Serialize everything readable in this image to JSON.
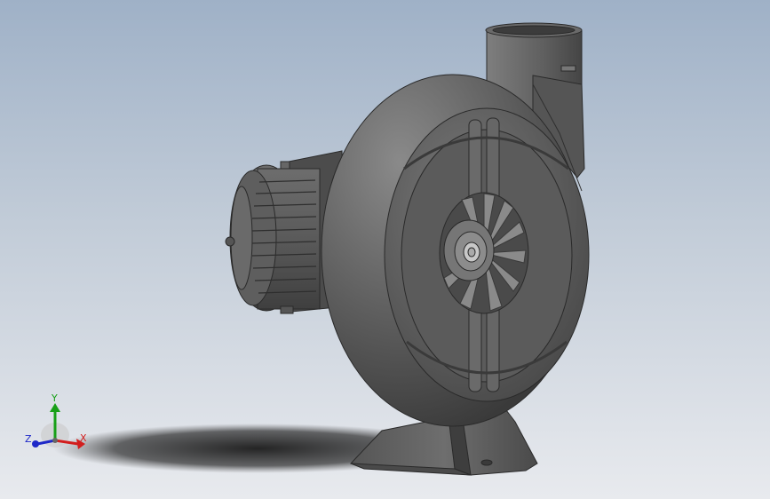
{
  "viewport": {
    "model_name": "",
    "background_top": "#9fb1c7",
    "background_bottom": "#e8eaee"
  },
  "triad": {
    "x_label": "X",
    "y_label": "Y",
    "z_label": "Z",
    "x_color": "#d21e1e",
    "y_color": "#18a018",
    "z_color": "#1e28c8"
  }
}
